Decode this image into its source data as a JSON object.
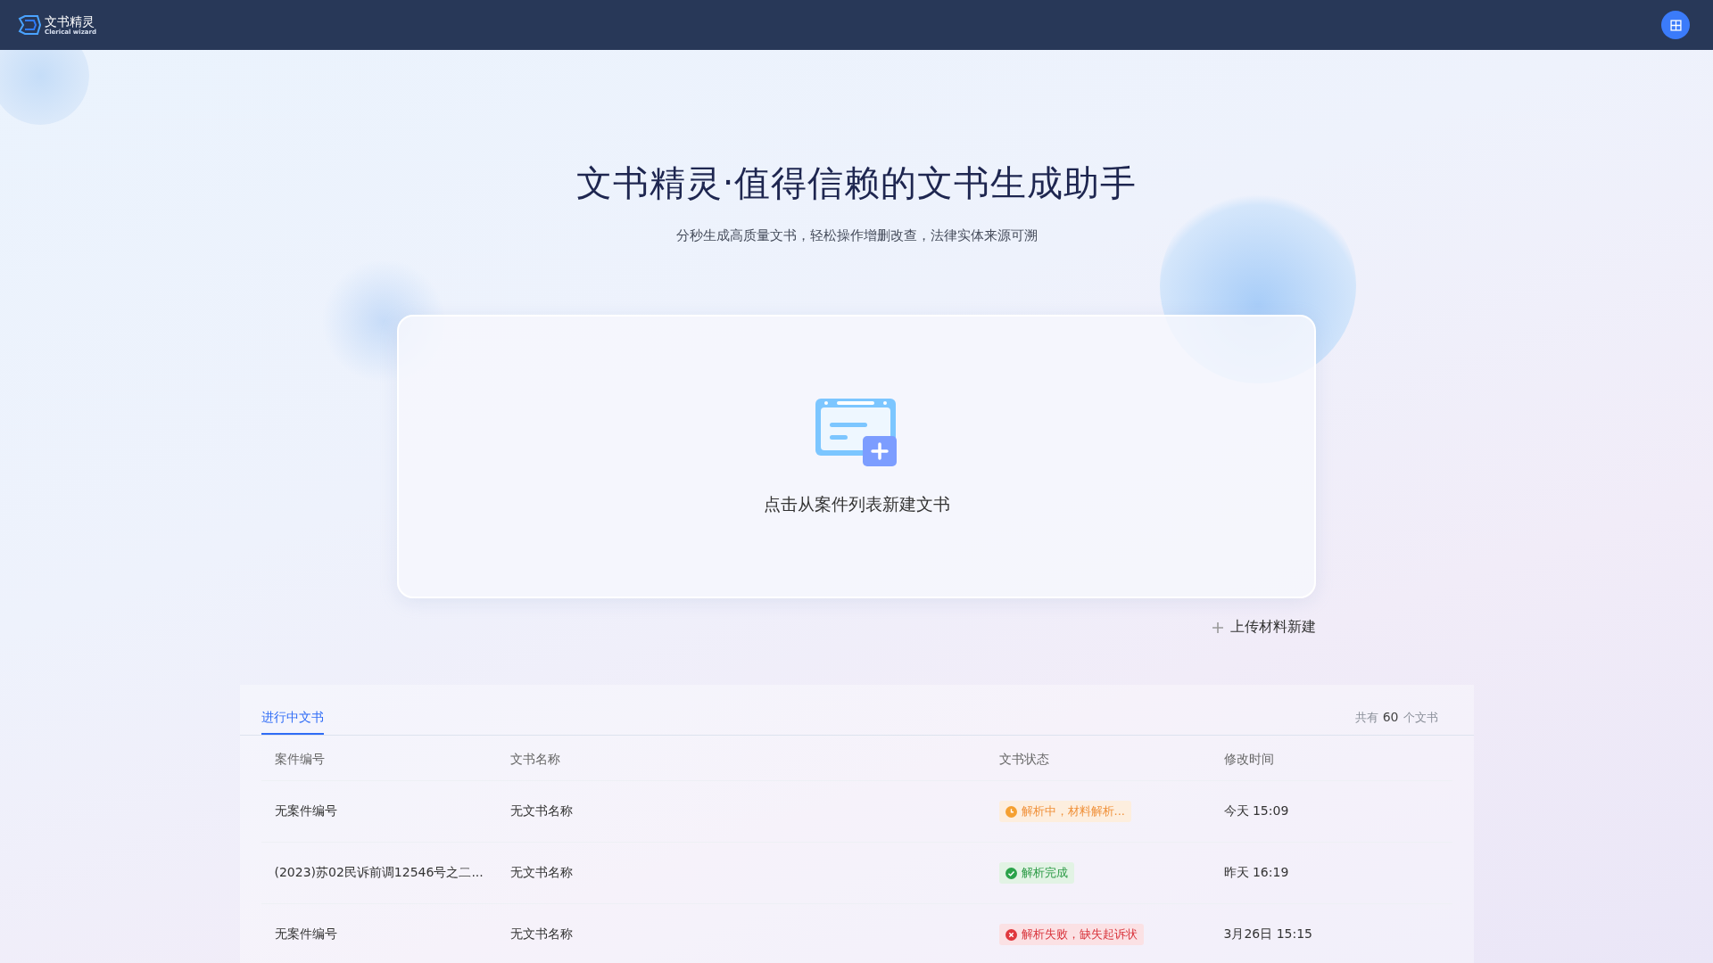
{
  "header": {
    "logo_title": "文书精灵",
    "logo_subtitle": "Clerical wizard"
  },
  "hero": {
    "title": "文书精灵·值得信赖的文书生成助手",
    "subtitle": "分秒生成高质量文书，轻松操作增删改查，法律实体来源可溯"
  },
  "create_card": {
    "label": "点击从案件列表新建文书"
  },
  "upload_link": {
    "label": "上传材料新建"
  },
  "documents": {
    "tabs": [
      {
        "label": "进行中文书",
        "selected": true
      }
    ],
    "count_prefix": "共有",
    "count": "60",
    "count_suffix": "个文书",
    "columns": [
      "案件编号",
      "文书名称",
      "文书状态",
      "修改时间"
    ],
    "rows": [
      {
        "case_no": "无案件编号",
        "doc_name": "无文书名称",
        "status": {
          "kind": "pending",
          "text": "解析中，材料解析..."
        },
        "modified": "今天 15:09"
      },
      {
        "case_no": "(2023)苏02民诉前调12546号之二...",
        "doc_name": "无文书名称",
        "status": {
          "kind": "done",
          "text": "解析完成"
        },
        "modified": "昨天 16:19"
      },
      {
        "case_no": "无案件编号",
        "doc_name": "无文书名称",
        "status": {
          "kind": "failed",
          "text": "解析失败，缺失起诉状"
        },
        "modified": "3月26日 15:15"
      }
    ]
  }
}
